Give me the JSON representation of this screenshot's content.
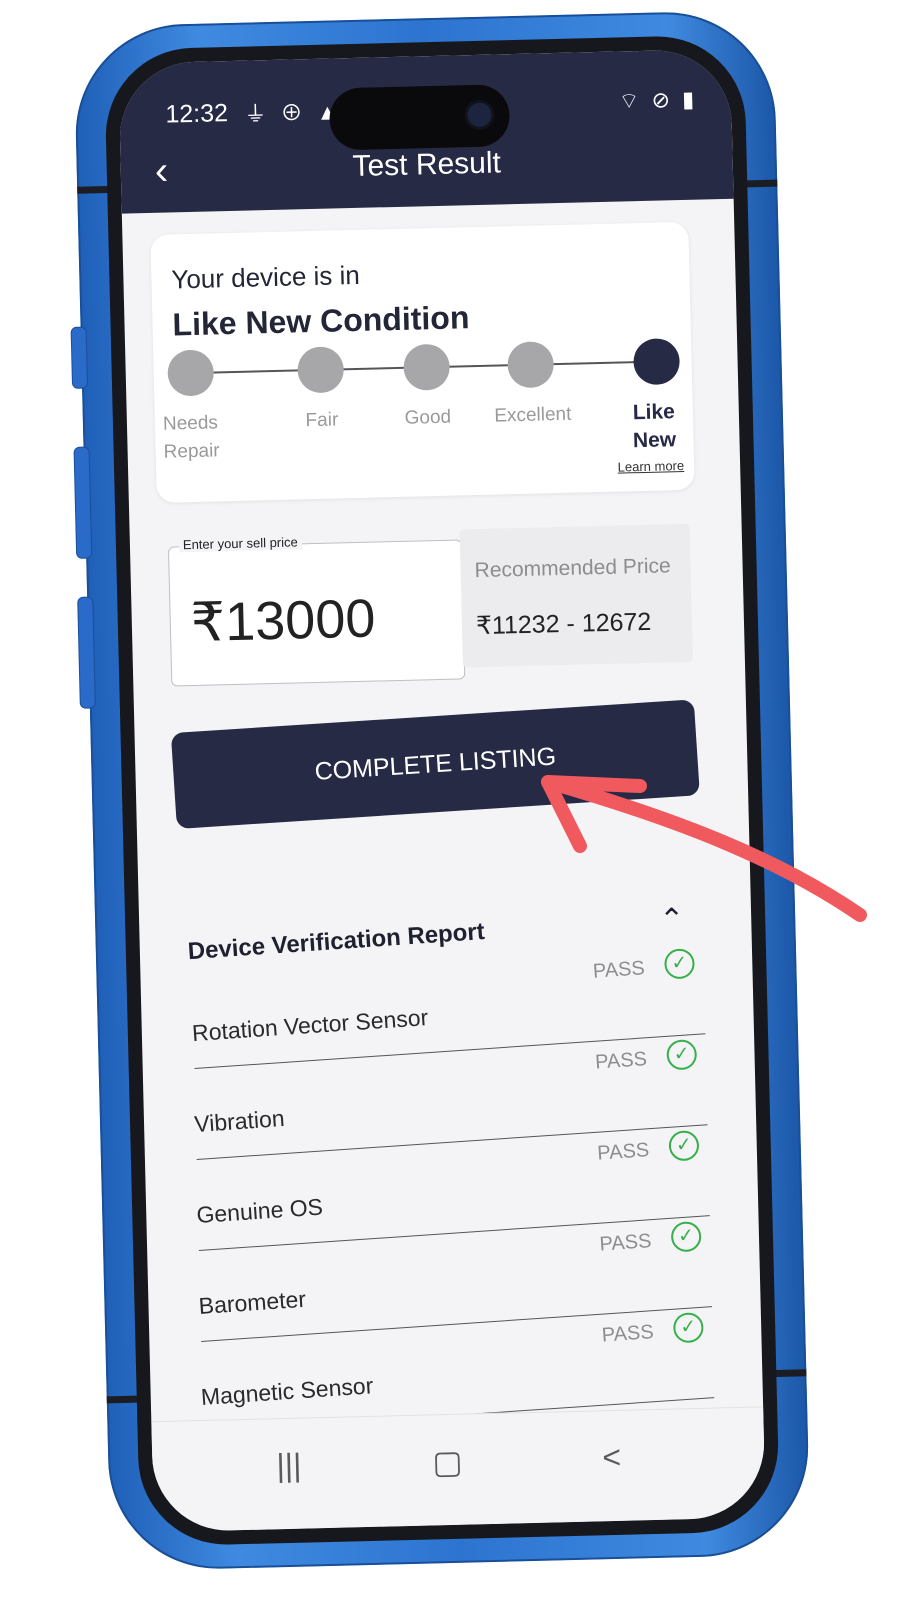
{
  "status_bar": {
    "time": "12:32",
    "left_icons": "⏚ ⊕ ▲ •",
    "right_icons": "⌔ ⊘ ▮"
  },
  "header": {
    "back_icon": "back-arrow-icon",
    "title": "Test Result"
  },
  "condition_card": {
    "intro": "Your device is in",
    "condition": "Like New Condition",
    "steps": [
      {
        "label": "Needs Repair",
        "active": false
      },
      {
        "label": "Fair",
        "active": false
      },
      {
        "label": "Good",
        "active": false
      },
      {
        "label": "Excellent",
        "active": false
      },
      {
        "label": "Like New",
        "active": true
      }
    ],
    "learn_more": "Learn more"
  },
  "sell_price": {
    "legend": "Enter your sell price",
    "value": "₹13000"
  },
  "recommended": {
    "label": "Recommended Price",
    "value": "₹11232 - 12672"
  },
  "primary_button": "COMPLETE LISTING",
  "report": {
    "title": "Device Verification Report",
    "collapse_icon": "chevron-up-icon",
    "items": [
      {
        "name": "Rotation Vector Sensor",
        "status": "PASS"
      },
      {
        "name": "Vibration",
        "status": "PASS"
      },
      {
        "name": "Genuine OS",
        "status": "PASS"
      },
      {
        "name": "Barometer",
        "status": "PASS"
      },
      {
        "name": "Magnetic Sensor",
        "status": "PASS"
      }
    ]
  },
  "nav": {
    "recents": "|||",
    "home": "▢",
    "back": "<"
  },
  "colors": {
    "header": "#272a45",
    "phone_frame": "#2d74d0",
    "pass": "#35b04a",
    "annotation_arrow": "#f05a5f"
  }
}
